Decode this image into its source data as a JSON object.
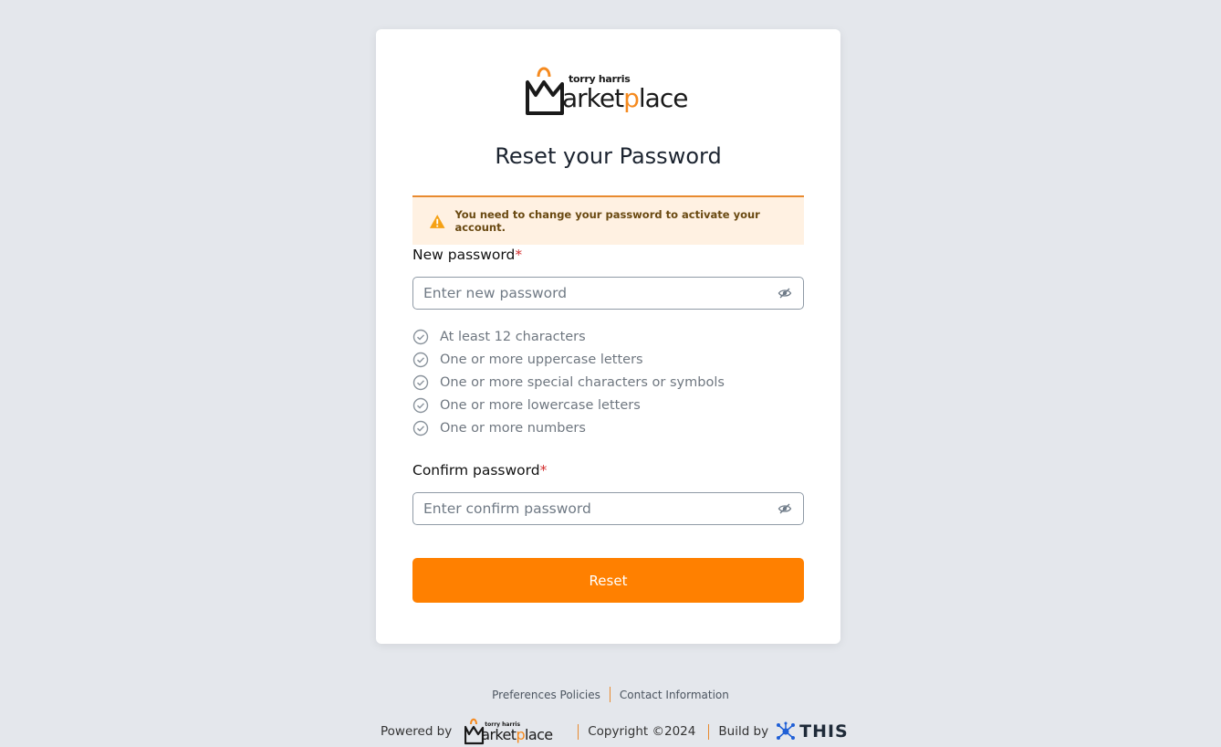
{
  "brand": {
    "logo_small": "torry harris",
    "logo_big_prefix": "arket",
    "logo_big_accent": "p",
    "logo_big_suffix": "lace",
    "accent_color": "#ff8000"
  },
  "page": {
    "title": "Reset your Password"
  },
  "alert": {
    "icon": "warning-icon",
    "message": "You need to change your password to activate your account."
  },
  "new_password": {
    "label": "New password",
    "required_mark": "*",
    "placeholder": "Enter new password",
    "value": "",
    "toggle_icon": "eye-slash-icon"
  },
  "rules": [
    "At least 12 characters",
    "One or more uppercase letters",
    "One or more special characters or symbols",
    "One or more lowercase letters",
    "One or more numbers"
  ],
  "confirm_password": {
    "label": "Confirm password",
    "required_mark": "*",
    "placeholder": "Enter confirm password",
    "value": "",
    "toggle_icon": "eye-slash-icon"
  },
  "reset_button": "Reset",
  "footer": {
    "links": [
      "Preferences Policies",
      "Contact Information"
    ],
    "powered_by": "Powered by",
    "copyright": "Copyright ©2024",
    "build_by": "Build by",
    "build_brand": "THIS"
  }
}
